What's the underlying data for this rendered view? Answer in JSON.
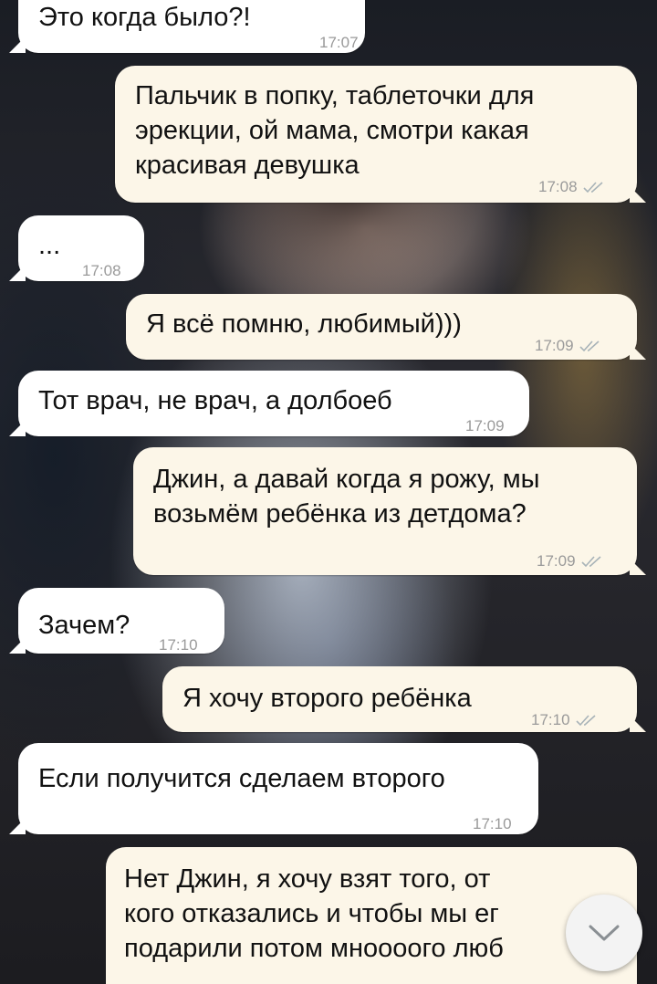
{
  "messages": [
    {
      "direction": "in",
      "text": "Это когда было?!",
      "time": "17:07"
    },
    {
      "direction": "out",
      "text": "Пальчик в попку, таблеточки для\nэрекции, ой мама, смотри какая\nкрасивая девушка",
      "time": "17:08"
    },
    {
      "direction": "in",
      "text": "...",
      "time": "17:08"
    },
    {
      "direction": "out",
      "text": "Я всё помню, любимый)))",
      "time": "17:09"
    },
    {
      "direction": "in",
      "text": "Тот врач, не врач, а долбоеб",
      "time": "17:09"
    },
    {
      "direction": "out",
      "text": "Джин, а давай когда я рожу, мы\nвозьмём ребёнка из детдома?",
      "time": "17:09"
    },
    {
      "direction": "in",
      "text": "Зачем?",
      "time": "17:10"
    },
    {
      "direction": "out",
      "text": "Я хочу второго ребёнка",
      "time": "17:10"
    },
    {
      "direction": "in",
      "text": "Если получится сделаем второго",
      "time": "17:10"
    },
    {
      "direction": "out",
      "text": "Нет Джин, я хочу взят того, от\nкого отказались и чтобы мы ег\nподарили потом мноооого люб",
      "time": ""
    }
  ],
  "colors": {
    "incoming_bubble": "#ffffff",
    "outgoing_bubble": "#fcf6e8",
    "read_ticks": "#a8b3b8"
  },
  "icons": {
    "read_receipt": "double-check-icon",
    "scroll_down": "chevron-down-icon"
  }
}
